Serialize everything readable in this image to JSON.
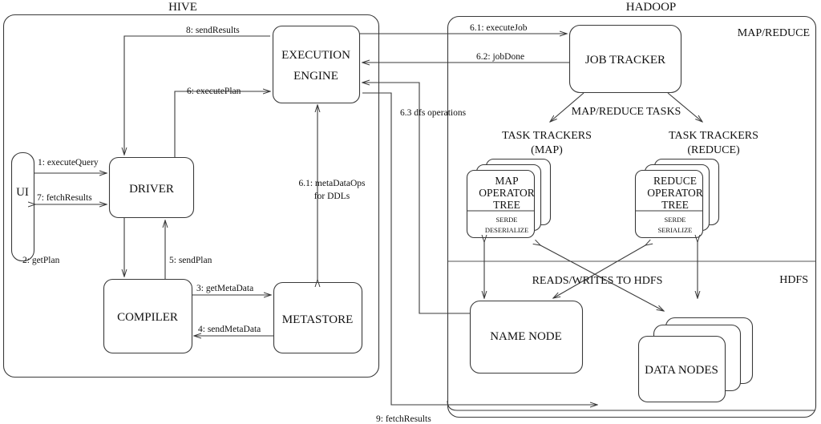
{
  "zones": {
    "hive": "HIVE",
    "hadoop": "HADOOP",
    "mapreduce": "MAP/REDUCE",
    "hdfs": "HDFS"
  },
  "boxes": {
    "ui": "UI",
    "driver": "DRIVER",
    "compiler": "COMPILER",
    "metastore": "METASTORE",
    "execution_engine_l1": "EXECUTION",
    "execution_engine_l2": "ENGINE",
    "job_tracker": "JOB TRACKER",
    "task_trackers_map_l1": "TASK TRACKERS",
    "task_trackers_map_l2": "(MAP)",
    "task_trackers_reduce_l1": "TASK TRACKERS",
    "task_trackers_reduce_l2": "(REDUCE)",
    "map_operator_l1": "MAP",
    "map_operator_l2": "OPERATOR",
    "map_operator_l3": "TREE",
    "map_serde_l1": "SERDE",
    "map_serde_l2": "DESERIALIZE",
    "reduce_operator_l1": "REDUCE",
    "reduce_operator_l2": "OPERATOR",
    "reduce_operator_l3": "TREE",
    "reduce_serde_l1": "SERDE",
    "reduce_serde_l2": "SERIALIZE",
    "name_node": "NAME NODE",
    "data_nodes": "DATA NODES"
  },
  "messages": {
    "m1": "1: executeQuery",
    "m2": "2: getPlan",
    "m3": "3: getMetaData",
    "m4": "4: sendMetaData",
    "m5": "5: sendPlan",
    "m6": "6: executePlan",
    "m61_meta_l1": "6.1: metaDataOps",
    "m61_meta_l2": "for DDLs",
    "m61_job": "6.1: executeJob",
    "m62": "6.2: jobDone",
    "m63": "6.3 dfs operations",
    "m7": "7: fetchResults",
    "m8": "8: sendResults",
    "m9": "9: fetchResults",
    "mr_tasks": "MAP/REDUCE TASKS",
    "reads_writes": "READS/WRITES TO HDFS"
  }
}
